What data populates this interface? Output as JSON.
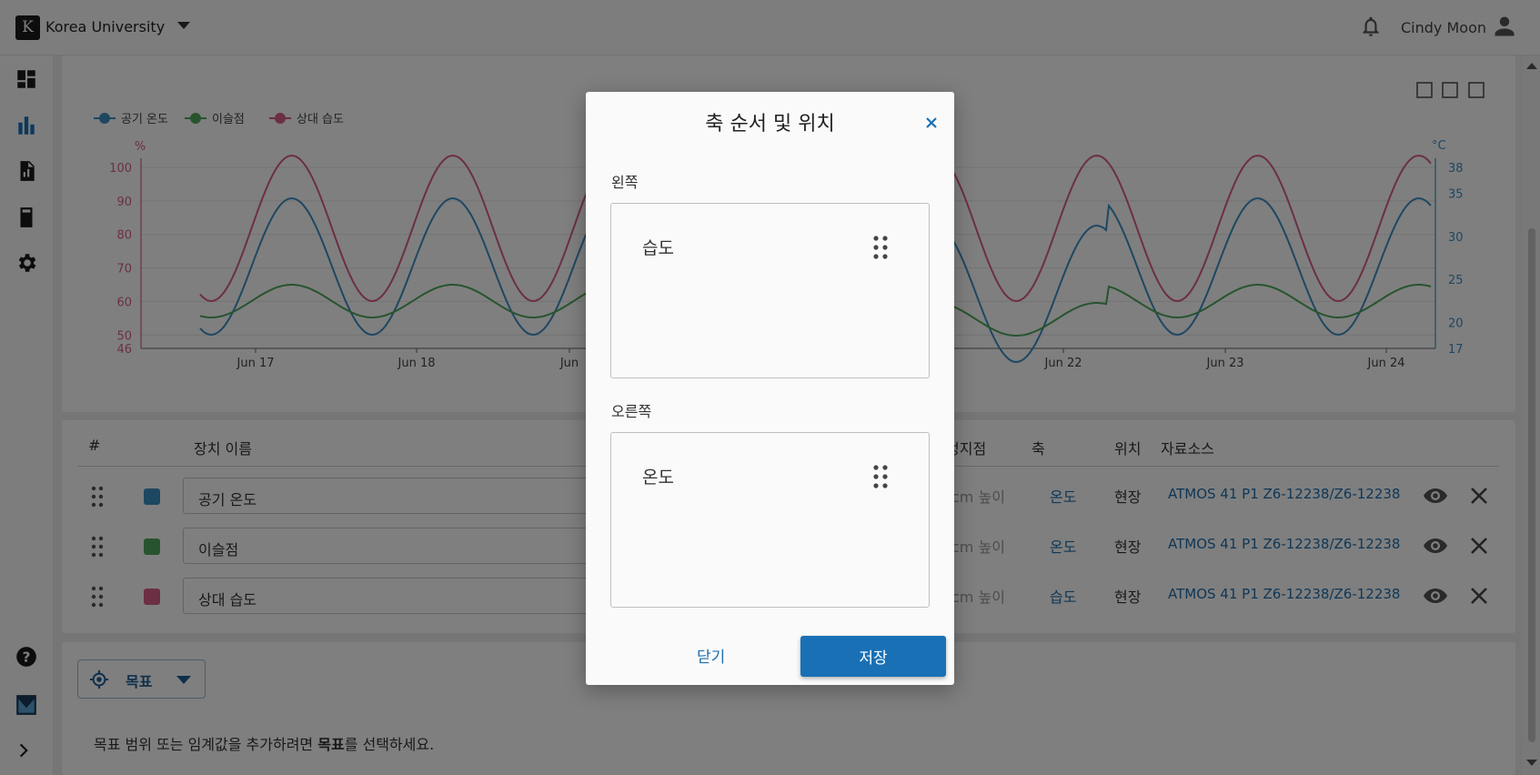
{
  "header": {
    "logo_letter": "K",
    "org_name": "Korea University",
    "user_name": "Cindy Moon"
  },
  "chart_data": {
    "type": "line",
    "legend": [
      "공기 온도",
      "이슬점",
      "상대 습도"
    ],
    "legend_position": "top-left",
    "series": [
      {
        "name": "공기 온도",
        "color": "#3d8ec4",
        "axis": "right"
      },
      {
        "name": "이슬점",
        "color": "#4ea85c",
        "axis": "right"
      },
      {
        "name": "상대 습도",
        "color": "#d95f86",
        "axis": "left"
      }
    ],
    "left_axis": {
      "unit": "%",
      "ticks": [
        "100",
        "90",
        "80",
        "70",
        "60",
        "50",
        "46"
      ],
      "range": [
        46,
        100
      ],
      "color": "#d95f86"
    },
    "right_axis": {
      "unit": "°C",
      "ticks": [
        "38",
        "35",
        "30",
        "25",
        "20",
        "17"
      ],
      "range": [
        17,
        38
      ],
      "color": "#3d8ec4"
    },
    "x_ticks": [
      "Jun 17",
      "Jun 18",
      "Jun",
      "Jun 22",
      "Jun 23",
      "Jun 24"
    ],
    "grid": true
  },
  "table": {
    "headers": {
      "num": "#",
      "device_name": "장치 이름",
      "point": "정지점",
      "axis": "축",
      "location": "위치",
      "source": "자료소스"
    },
    "rows": [
      {
        "color": "#3d8ec4",
        "name": "공기 온도",
        "height": "cm 높이",
        "axis": "온도",
        "location": "현장",
        "source": "ATMOS 41 P1 Z6-12238/Z6-12238"
      },
      {
        "color": "#4ea85c",
        "name": "이슬점",
        "height": "cm 높이",
        "axis": "온도",
        "location": "현장",
        "source": "ATMOS 41 P1 Z6-12238/Z6-12238"
      },
      {
        "color": "#d95f86",
        "name": "상대 습도",
        "height": "cm 높이",
        "axis": "습도",
        "location": "현장",
        "source": "ATMOS 41 P1 Z6-12238/Z6-12238"
      }
    ]
  },
  "target": {
    "button_label": "목표",
    "hint_before": "목표 범위 또는 임계값을 추가하려면 ",
    "hint_bold": "목표",
    "hint_after": "를 선택하세요."
  },
  "modal": {
    "title": "축 순서 및 위치",
    "left_label": "왼쪽",
    "left_item": "습도",
    "right_label": "오른쪽",
    "right_item": "온도",
    "close_label": "닫기",
    "save_label": "저장"
  }
}
